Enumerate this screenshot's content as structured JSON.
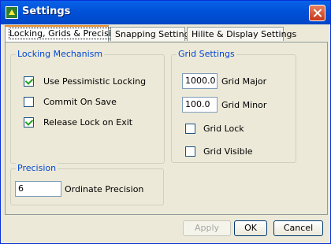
{
  "window": {
    "title": "Settings"
  },
  "tabs": [
    {
      "label": "Locking, Grids & Precision",
      "active": true
    },
    {
      "label": "Snapping Settings",
      "active": false
    },
    {
      "label": "Hilite & Display Settings",
      "active": false
    }
  ],
  "locking": {
    "title": "Locking Mechanism",
    "options": [
      {
        "label": "Use Pessimistic Locking",
        "checked": true
      },
      {
        "label": "Commit On Save",
        "checked": false
      },
      {
        "label": "Release Lock on Exit",
        "checked": true
      }
    ]
  },
  "grid": {
    "title": "Grid Settings",
    "major_value": "1000.0",
    "major_label": "Grid Major",
    "minor_value": "100.0",
    "minor_label": "Grid Minor",
    "lock_label": "Grid Lock",
    "lock_checked": false,
    "visible_label": "Grid Visible",
    "visible_checked": false
  },
  "precision": {
    "title": "Precision",
    "value": "6",
    "label": "Ordinate Precision"
  },
  "buttons": {
    "apply": "Apply",
    "ok": "OK",
    "cancel": "Cancel"
  }
}
